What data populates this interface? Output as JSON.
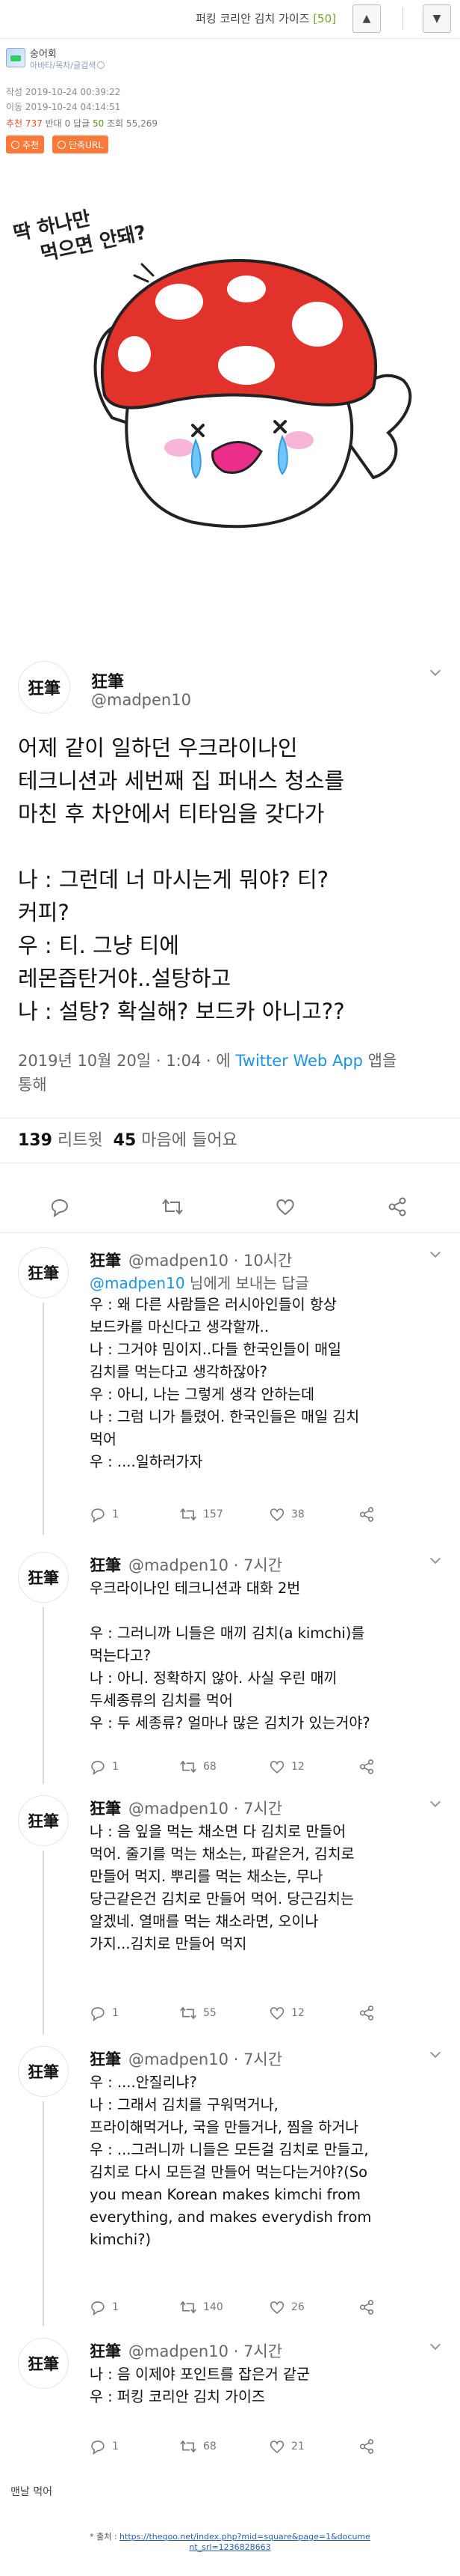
{
  "header": {
    "title": "퍼킹 코리안 김치 가이즈",
    "comment_count": "[50]",
    "up_icon": "▲",
    "down_icon": "▼"
  },
  "meta": {
    "author": "숭어회",
    "role": "아바타/목차/글검색",
    "written_label": "작성",
    "written": "2019-10-24 00:39:22",
    "moved_label": "이동",
    "moved": "2019-10-24 04:14:51",
    "stats_recommend_label": "추천",
    "stats_recommend": "737",
    "stats_oppose_label": "반대",
    "stats_oppose": "0",
    "stats_reply_label": "답글",
    "stats_reply": "50",
    "stats_views_label": "조회",
    "stats_views": "55,269",
    "recommend_button": "추천",
    "shorturl_button": "단축URL"
  },
  "illustration": {
    "caption_line1": "딱 하나만",
    "caption_line2": "먹으면 안돼?"
  },
  "main_tweet": {
    "name": "狂筆",
    "handle": "@madpen10",
    "avatar_text": "狂筆",
    "body": "어제 같이 일하던 우크라이나인\n테크니션과 세번째 집 퍼내스 청소를\n마친 후 차안에서 티타임을 갖다가\n\n나 : 그런데 너 마시는게 뭐야? 티?\n커피?\n우 : 티. 그냥 티에\n레몬즙탄거야..설탕하고\n나 : 설탕? 확실해? 보드카 아니고??",
    "time": "2019년 10월 20일 · 1:04 · 에",
    "client": "Twitter Web App",
    "via": "앱을",
    "via2": "통해",
    "retweets": "139",
    "retweets_label": "리트윗",
    "likes": "45",
    "likes_label": "마음에 들어요"
  },
  "replies": [
    {
      "name": "狂筆",
      "handle": "@madpen10 · 10시간",
      "reply_to_handle": "@madpen10",
      "reply_to_text": "님에게 보내는 답글",
      "body": "우 : 왜 다른 사람들은 러시아인들이 항상\n보드카를 마신다고 생각할까..\n나 : 그거야 밈이지..다들 한국인들이 매일\n김치를 먹는다고 생각하잖아?\n우 : 아니, 나는 그렇게 생각 안하는데\n나 : 그럼 니가 틀렸어. 한국인들은 매일 김치\n먹어\n우 : ....일하러가자",
      "replies": "1",
      "retweets": "157",
      "likes": "38"
    },
    {
      "name": "狂筆",
      "handle": "@madpen10 · 7시간",
      "body": "우크라이나인 테크니션과 대화 2번\n\n우 : 그러니까 니들은 매끼 김치(a kimchi)를\n먹는다고?\n나 : 아니. 정확하지 않아. 사실 우린 매끼\n두세종류의 김치를 먹어\n우 : 두 세종류? 얼마나 많은 김치가 있는거야?",
      "replies": "1",
      "retweets": "68",
      "likes": "12"
    },
    {
      "name": "狂筆",
      "handle": "@madpen10 · 7시간",
      "body": "나 : 음 잎을 먹는 채소면 다 김치로 만들어\n먹어. 줄기를 먹는 채소는, 파같은거, 김치로\n만들어 먹지. 뿌리를 먹는 채소는, 무나\n당근같은건 김치로 만들어 먹어. 당근김치는\n알겠네. 열매를 먹는 채소라면, 오이나\n가지...김치로 만들어 먹지",
      "replies": "1",
      "retweets": "55",
      "likes": "12"
    },
    {
      "name": "狂筆",
      "handle": "@madpen10 · 7시간",
      "body": "우 : ....안질리냐?\n나 : 그래서 김치를 구워먹거나,\n프라이해먹거나, 국을 만들거나, 찜을 하거나\n우 : ...그러니까 니들은 모든걸 김치로 만들고,\n김치로 다시 모든걸 만들어 먹는다는거야?(So\nyou mean Korean makes kimchi from\neverything, and makes everydish from\nkimchi?)",
      "replies": "1",
      "retweets": "140",
      "likes": "26"
    },
    {
      "name": "狂筆",
      "handle": "@madpen10 · 7시간",
      "body": "나 : 음 이제야 포인트를 잡은거 같군\n우 : 퍼킹 코리안 김치 가이즈",
      "replies": "1",
      "retweets": "68",
      "likes": "21"
    }
  ],
  "footer": {
    "note": "맨날 먹어",
    "source_label": "* 출처 :",
    "source_url_line1": "https://theqoo.net/index.php?mid=square&page=1&docume",
    "source_url_line2": "nt_srl=1236828663"
  },
  "colors": {
    "accent_orange": "#ff7a38",
    "twitter_blue": "#1b95e0",
    "recommend_red": "#e2502b",
    "reply_green": "#5a9a1c"
  }
}
